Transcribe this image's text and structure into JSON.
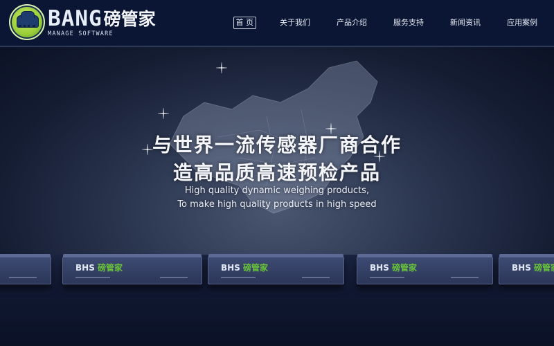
{
  "brand": {
    "latin": "BANG",
    "chinese": "磅管家",
    "tagline": "MANAGE SOFTWARE"
  },
  "nav": {
    "items": [
      {
        "label": "首 页",
        "active": true
      },
      {
        "label": "关于我们",
        "active": false
      },
      {
        "label": "产品介绍",
        "active": false
      },
      {
        "label": "服务支持",
        "active": false
      },
      {
        "label": "新闻资讯",
        "active": false
      },
      {
        "label": "应用案例",
        "active": false
      }
    ]
  },
  "hero": {
    "headline_1": "与世界一流传感器厂商合作",
    "headline_2": "造高品质高速预检产品",
    "subline_1": "High quality dynamic weighing products,",
    "subline_2": "To make high quality products in high speed"
  },
  "devices": {
    "label_prefix": "BHS",
    "label_cn": "磅管家"
  },
  "colors": {
    "header_bg": "#0a1634",
    "accent_green": "#67c23a",
    "text_light": "#f4f6fa"
  }
}
